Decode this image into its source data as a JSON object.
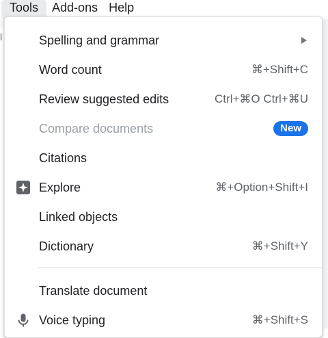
{
  "menubar": {
    "items": [
      {
        "label": "Tools"
      },
      {
        "label": "Add-ons"
      },
      {
        "label": "Help"
      }
    ]
  },
  "edge_glyph": "l",
  "menu": {
    "items": [
      {
        "label": "Spelling and grammar",
        "submenu": true
      },
      {
        "label": "Word count",
        "shortcut": "⌘+Shift+C"
      },
      {
        "label": "Review suggested edits",
        "shortcut": "Ctrl+⌘O Ctrl+⌘U"
      },
      {
        "label": "Compare documents",
        "disabled": true,
        "badge": "New"
      },
      {
        "label": "Citations"
      },
      {
        "label": "Explore",
        "icon": "explore-icon",
        "shortcut": "⌘+Option+Shift+I"
      },
      {
        "label": "Linked objects"
      },
      {
        "label": "Dictionary",
        "shortcut": "⌘+Shift+Y"
      },
      {
        "label": "Translate document"
      },
      {
        "label": "Voice typing",
        "icon": "microphone-icon",
        "shortcut": "⌘+Shift+S"
      }
    ]
  },
  "colors": {
    "accent": "#1a73e8",
    "text": "#202124",
    "disabled": "#9aa0a6",
    "shortcut": "#5f6368"
  }
}
